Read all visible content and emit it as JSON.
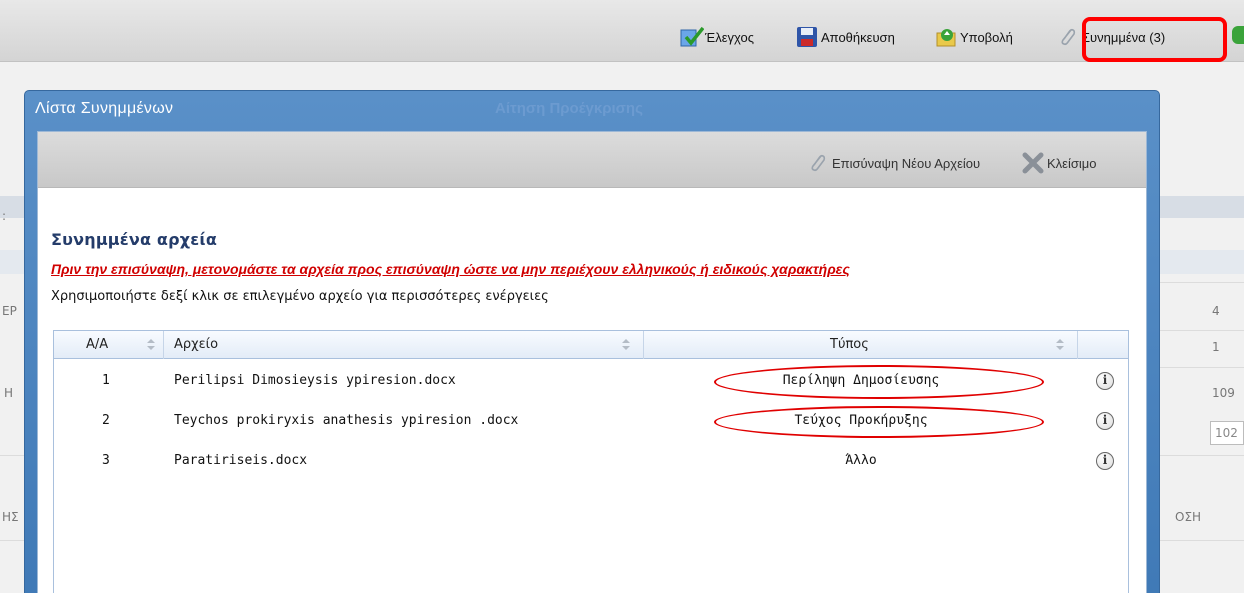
{
  "toolbar": {
    "check_label": "Έλεγχος",
    "save_label": "Αποθήκευση",
    "submit_label": "Υποβολή",
    "attachments_label": "Συνημμένα (3)"
  },
  "background": {
    "left_labels": [
      "ΕΡ",
      "Η",
      "ΗΣ"
    ],
    "right_values": [
      "4",
      "1",
      "109",
      "102"
    ],
    "right_label": "ΟΣΗ",
    "colon": ":"
  },
  "dialog": {
    "title": "Λίστα Συνημμένων",
    "ghost_title": "Αίτηση Προέγκρισης",
    "attach_new_label": "Επισύναψη Νέου Αρχείου",
    "close_label": "Κλείσιμο",
    "heading": "Συνημμένα αρχεία",
    "warning": "Πριν την επισύναψη, μετονομάστε τα αρχεία προς επισύναψη ώστε να μην περιέχουν ελληνικούς ή ειδικούς χαρακτήρες",
    "hint": "Χρησιμοποιήστε δεξί κλικ σε επιλεγμένο αρχείο για περισσότερες ενέργειες"
  },
  "grid": {
    "columns": [
      "Α/Α",
      "Αρχείο",
      "Τύπος"
    ],
    "rows": [
      {
        "num": "1",
        "file": "Perilipsi Dimosieysis ypiresion.docx",
        "type": "Περίληψη Δημοσίευσης"
      },
      {
        "num": "2",
        "file": "Teychos prokiryxis anathesis ypiresion .docx",
        "type": "Τεύχος Προκήρυξης"
      },
      {
        "num": "3",
        "file": "Paratiriseis.docx",
        "type": "Άλλο"
      }
    ]
  },
  "colors": {
    "highlight": "#ff0000",
    "window_blue": "#4a84c0",
    "warning_red": "#d00000",
    "heading_navy": "#243c6a"
  },
  "icons": [
    "check-icon",
    "save-icon",
    "submit-icon",
    "paperclip-icon",
    "close-x-icon",
    "info-icon",
    "sort-icon"
  ]
}
